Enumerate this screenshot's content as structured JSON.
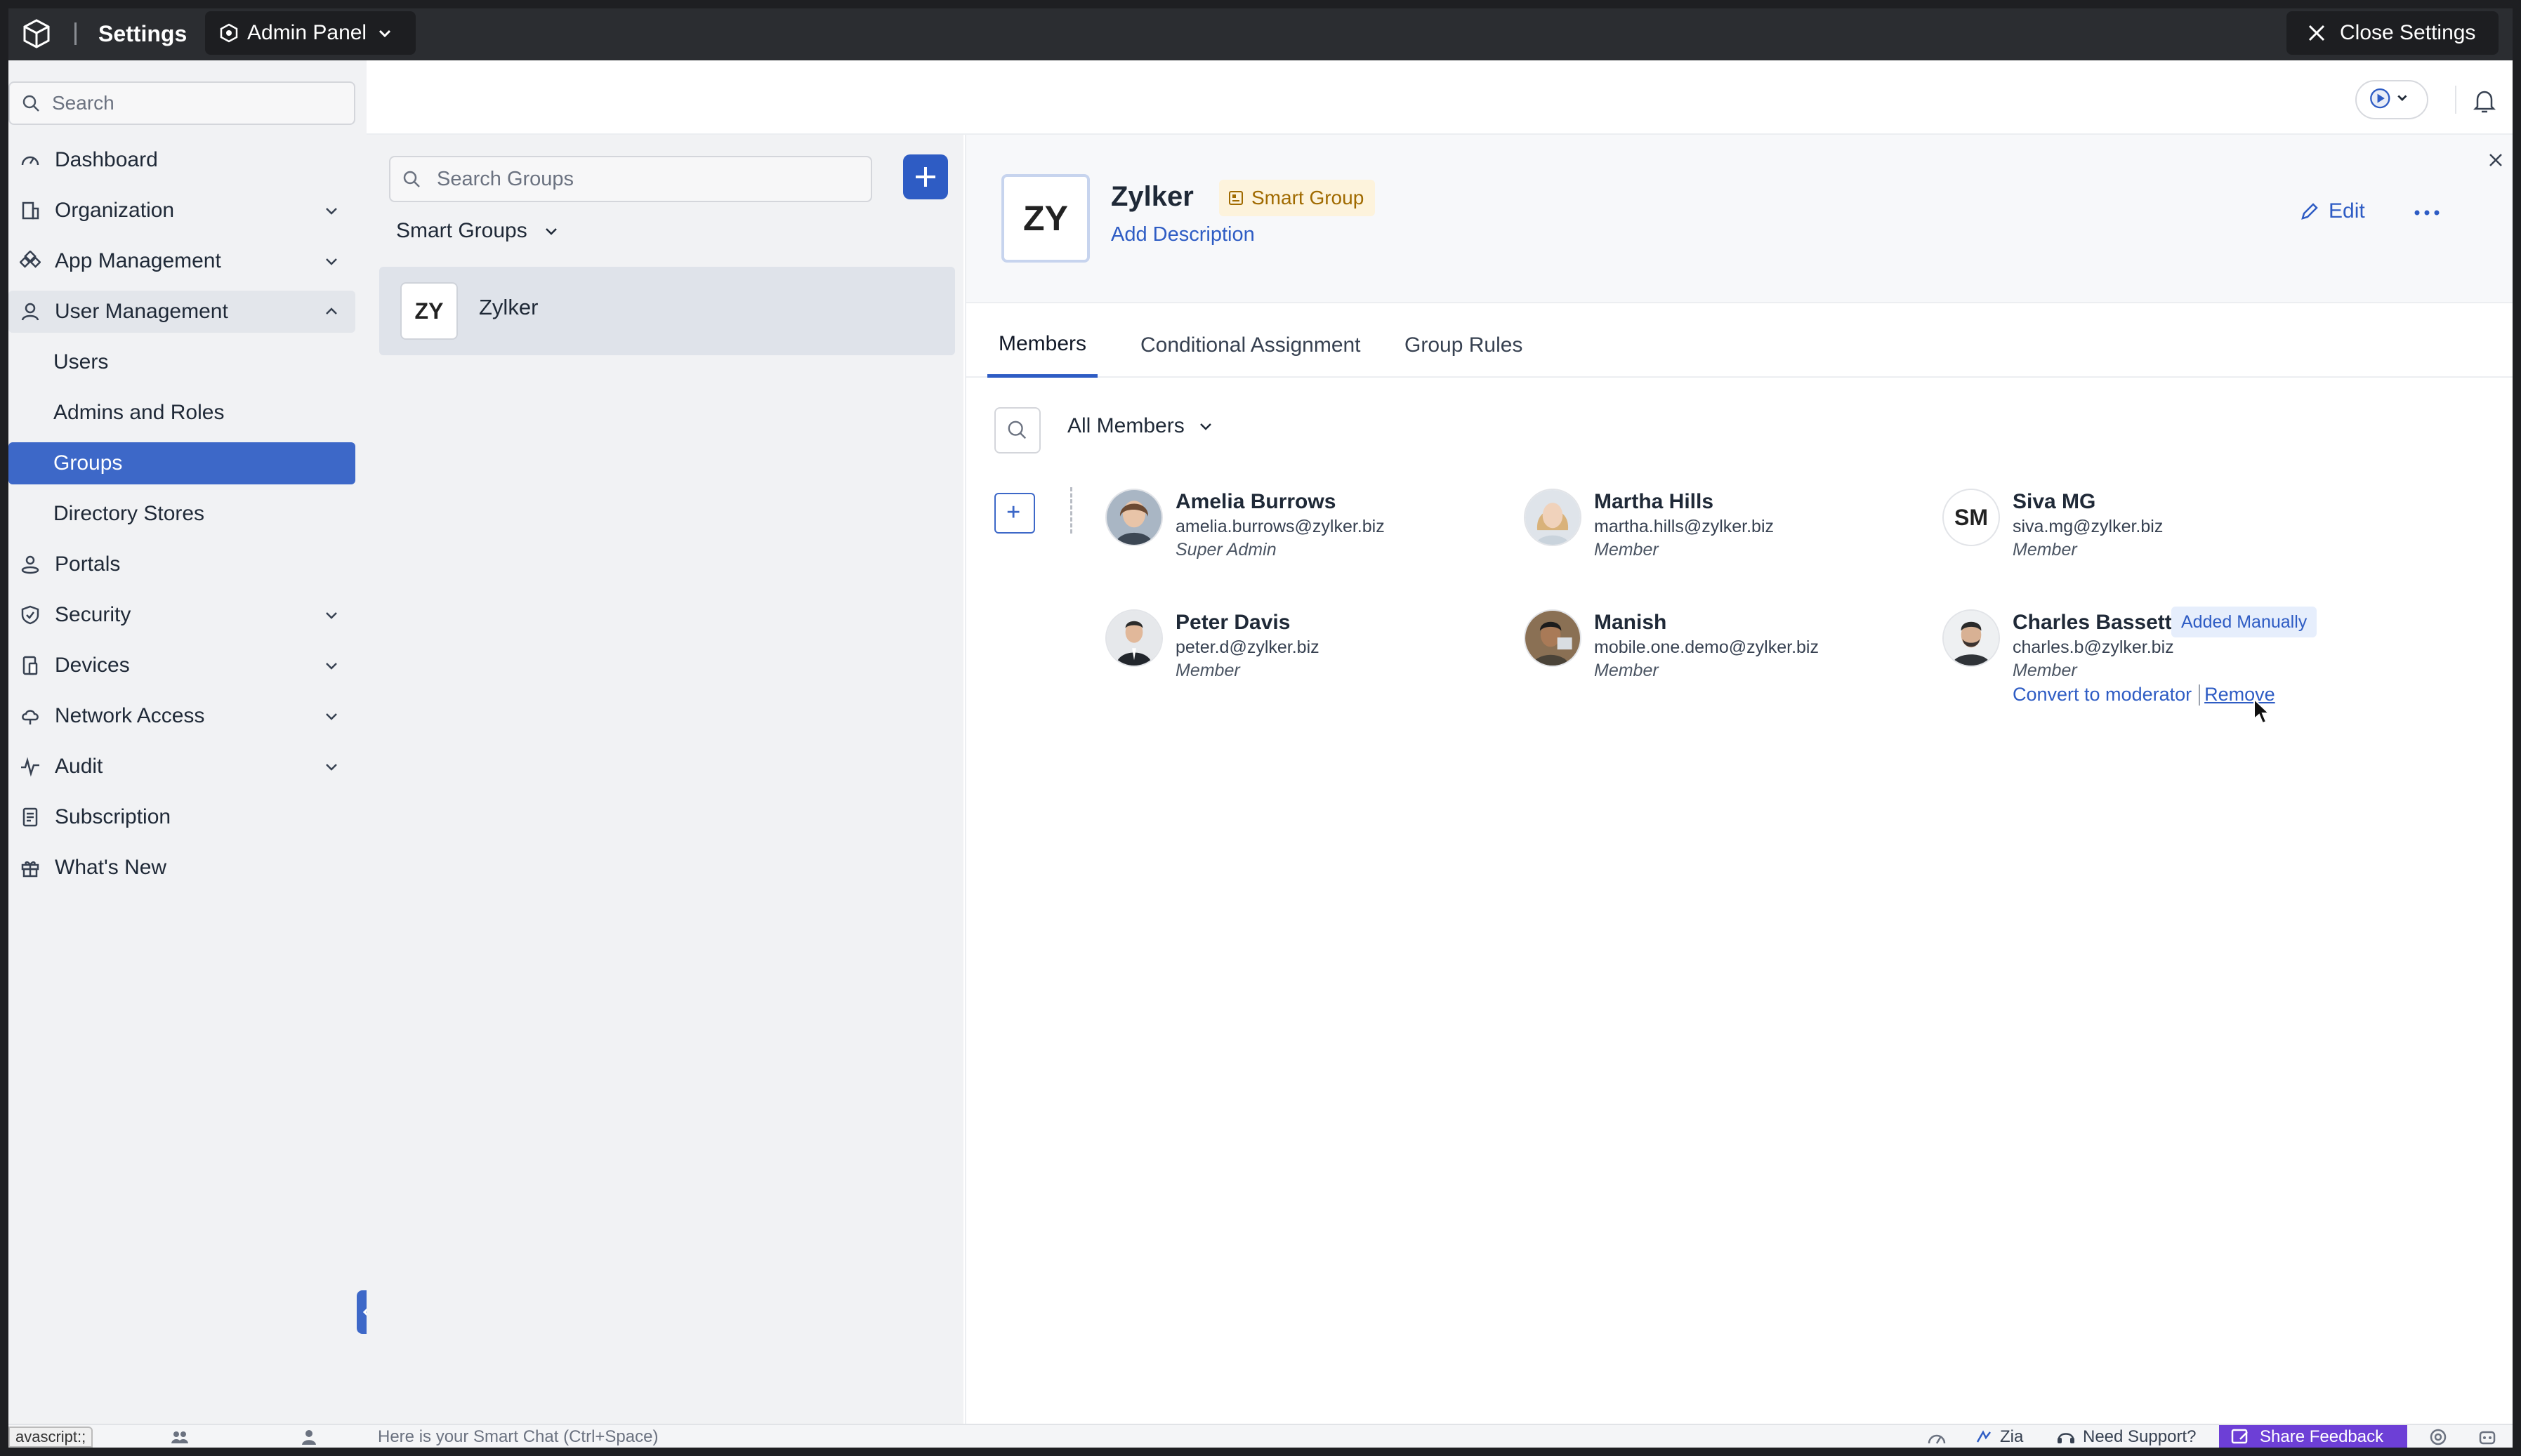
{
  "topbar": {
    "title": "Settings",
    "panel_label": "Admin Panel",
    "close_label": "Close Settings"
  },
  "sidebar": {
    "search_placeholder": "Search",
    "items": [
      {
        "label": "Dashboard",
        "icon": "dashboard-icon"
      },
      {
        "label": "Organization",
        "icon": "organization-icon"
      },
      {
        "label": "App Management",
        "icon": "app-management-icon"
      },
      {
        "label": "User Management",
        "icon": "user-icon"
      },
      {
        "label": "Users"
      },
      {
        "label": "Admins and Roles"
      },
      {
        "label": "Groups"
      },
      {
        "label": "Directory Stores"
      },
      {
        "label": "Portals",
        "icon": "portals-icon"
      },
      {
        "label": "Security",
        "icon": "shield-icon"
      },
      {
        "label": "Devices",
        "icon": "devices-icon"
      },
      {
        "label": "Network Access",
        "icon": "cloud-icon"
      },
      {
        "label": "Audit",
        "icon": "audit-icon"
      },
      {
        "label": "Subscription",
        "icon": "subscription-icon"
      },
      {
        "label": "What's New",
        "icon": "gift-icon"
      }
    ]
  },
  "groups": {
    "search_placeholder": "Search Groups",
    "filter_label": "Smart Groups",
    "list": [
      {
        "initials": "ZY",
        "name": "Zylker"
      }
    ]
  },
  "detail": {
    "initials": "ZY",
    "name": "Zylker",
    "badge": "Smart Group",
    "add_description": "Add Description",
    "edit_label": "Edit",
    "tabs": [
      "Members",
      "Conditional Assignment",
      "Group Rules"
    ],
    "member_filter": "All Members",
    "members": [
      {
        "name": "Amelia Burrows",
        "email": "amelia.burrows@zylker.biz",
        "role": "Super Admin"
      },
      {
        "name": "Martha Hills",
        "email": "martha.hills@zylker.biz",
        "role": "Member"
      },
      {
        "name": "Siva MG",
        "initials": "SM",
        "email": "siva.mg@zylker.biz",
        "role": "Member"
      },
      {
        "name": "Peter Davis",
        "email": "peter.d@zylker.biz",
        "role": "Member"
      },
      {
        "name": "Manish",
        "email": "mobile.one.demo@zylker.biz",
        "role": "Member"
      },
      {
        "name": "Charles Bassett",
        "email": "charles.b@zylker.biz",
        "role": "Member",
        "tag": "Added Manually",
        "action_convert": "Convert to moderator",
        "action_remove": "Remove"
      }
    ]
  },
  "bottom": {
    "status": "avascript:;",
    "chat_placeholder": "Here is your Smart Chat (Ctrl+Space)",
    "zia": "Zia",
    "support": "Need Support?",
    "feedback": "Share Feedback"
  },
  "colors": {
    "accent": "#2e5cc4",
    "active_nav": "#3d68c8",
    "topbar": "#2b2d31",
    "badge_bg": "#fdf3dc",
    "feedback": "#6d3fd6"
  }
}
